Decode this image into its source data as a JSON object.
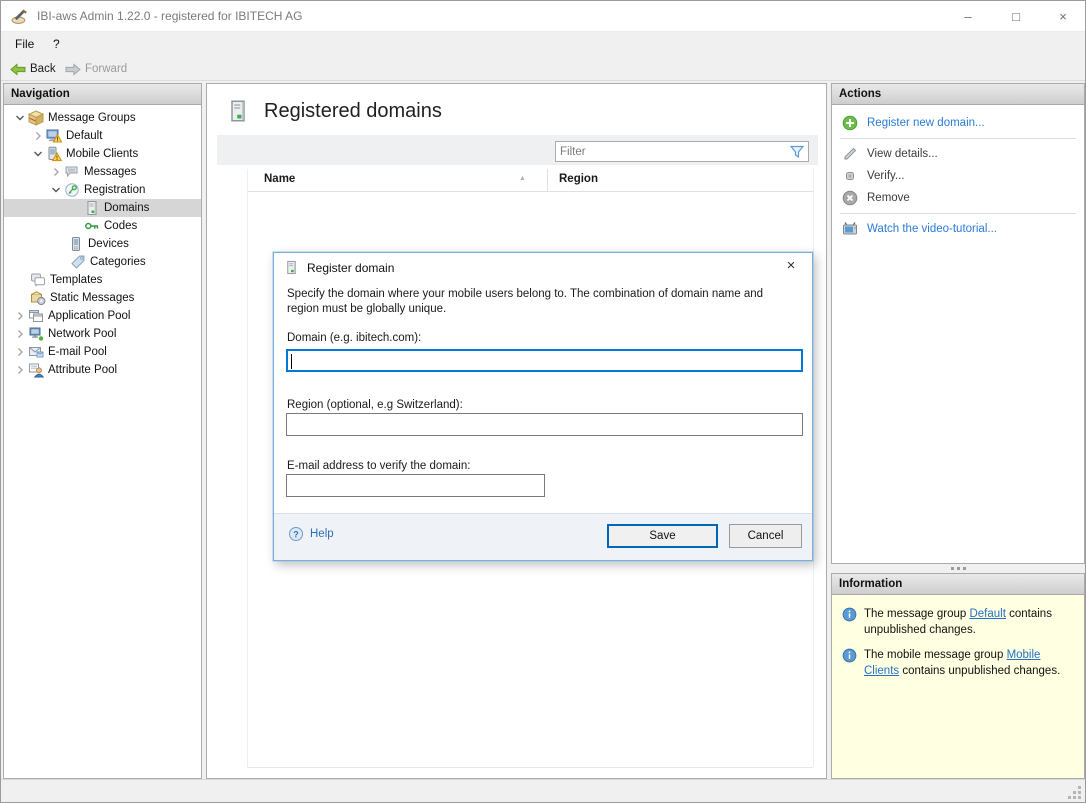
{
  "window": {
    "title": "IBI-aws Admin 1.22.0 - registered for IBITECH AG",
    "minimize_glyph": "–",
    "maximize_glyph": "□",
    "close_glyph": "×"
  },
  "menu": {
    "file": "File",
    "help": "?"
  },
  "toolbar": {
    "back": "Back",
    "forward": "Forward"
  },
  "navigation": {
    "header": "Navigation",
    "items": [
      {
        "label": "Message Groups",
        "icon": "message-groups-icon",
        "chevron": "down",
        "pad": 8,
        "selected": false
      },
      {
        "label": "Default",
        "icon": "monitor-warning-icon",
        "chevron": "right",
        "pad": 26,
        "selected": false
      },
      {
        "label": "Mobile Clients",
        "icon": "phone-warning-icon",
        "chevron": "down",
        "pad": 26,
        "selected": false
      },
      {
        "label": "Messages",
        "icon": "messages-icon",
        "chevron": "right",
        "pad": 44,
        "selected": false
      },
      {
        "label": "Registration",
        "icon": "registration-icon",
        "chevron": "down",
        "pad": 44,
        "selected": false
      },
      {
        "label": "Domains",
        "icon": "domain-icon",
        "chevron": "none",
        "pad": 80,
        "selected": true
      },
      {
        "label": "Codes",
        "icon": "key-icon",
        "chevron": "none",
        "pad": 80,
        "selected": false
      },
      {
        "label": "Devices",
        "icon": "device-icon",
        "chevron": "none",
        "pad": 64,
        "selected": false
      },
      {
        "label": "Categories",
        "icon": "tag-icon",
        "chevron": "none",
        "pad": 66,
        "selected": false
      },
      {
        "label": "Templates",
        "icon": "templates-icon",
        "chevron": "none",
        "pad": 26,
        "selected": false
      },
      {
        "label": "Static Messages",
        "icon": "static-messages-icon",
        "chevron": "none",
        "pad": 26,
        "selected": false
      },
      {
        "label": "Application Pool",
        "icon": "application-pool-icon",
        "chevron": "right",
        "pad": 8,
        "selected": false
      },
      {
        "label": "Network Pool",
        "icon": "network-pool-icon",
        "chevron": "right",
        "pad": 8,
        "selected": false
      },
      {
        "label": "E-mail Pool",
        "icon": "email-pool-icon",
        "chevron": "right",
        "pad": 8,
        "selected": false
      },
      {
        "label": "Attribute Pool",
        "icon": "attribute-pool-icon",
        "chevron": "right",
        "pad": 8,
        "selected": false
      }
    ]
  },
  "main": {
    "title": "Registered domains",
    "filter_placeholder": "Filter",
    "table": {
      "columns": [
        "Name",
        "Region"
      ],
      "rows": []
    }
  },
  "actions": {
    "header": "Actions",
    "items": [
      {
        "label": "Register new domain...",
        "icon": "plus-circle-icon",
        "enabled": true,
        "separator_after": true
      },
      {
        "label": "View details...",
        "icon": "pencil-icon",
        "enabled": false,
        "separator_after": false
      },
      {
        "label": "Verify...",
        "icon": "verify-icon",
        "enabled": false,
        "separator_after": false
      },
      {
        "label": "Remove",
        "icon": "remove-circle-icon",
        "enabled": false,
        "separator_after": true
      },
      {
        "label": "Watch the video-tutorial...",
        "icon": "tv-icon",
        "enabled": true,
        "separator_after": false
      }
    ]
  },
  "information": {
    "header": "Information",
    "items": [
      {
        "pre": "The message group ",
        "link": "Default",
        "post": " contains unpublished changes."
      },
      {
        "pre": "The mobile message group ",
        "link": "Mobile Clients",
        "post": " contains unpublished changes."
      }
    ]
  },
  "dialog": {
    "title": "Register domain",
    "description": "Specify the domain where your mobile users belong to. The combination of domain name and region must be globally unique.",
    "domain_label": "Domain (e.g. ibitech.com):",
    "domain_value": "",
    "region_label": "Region (optional, e.g Switzerland):",
    "region_value": "",
    "email_label": "E-mail  address to verify the domain:",
    "email_value": "",
    "help_label": "Help",
    "save_label": "Save",
    "cancel_label": "Cancel"
  },
  "colors": {
    "accent_blue": "#0067b8",
    "focus_blue": "#0078d7",
    "link_blue": "#2b7bd4",
    "info_background": "#ffffe1",
    "selected_row": "#d6d6d6",
    "back_arrow_green": "#8cc63e"
  }
}
